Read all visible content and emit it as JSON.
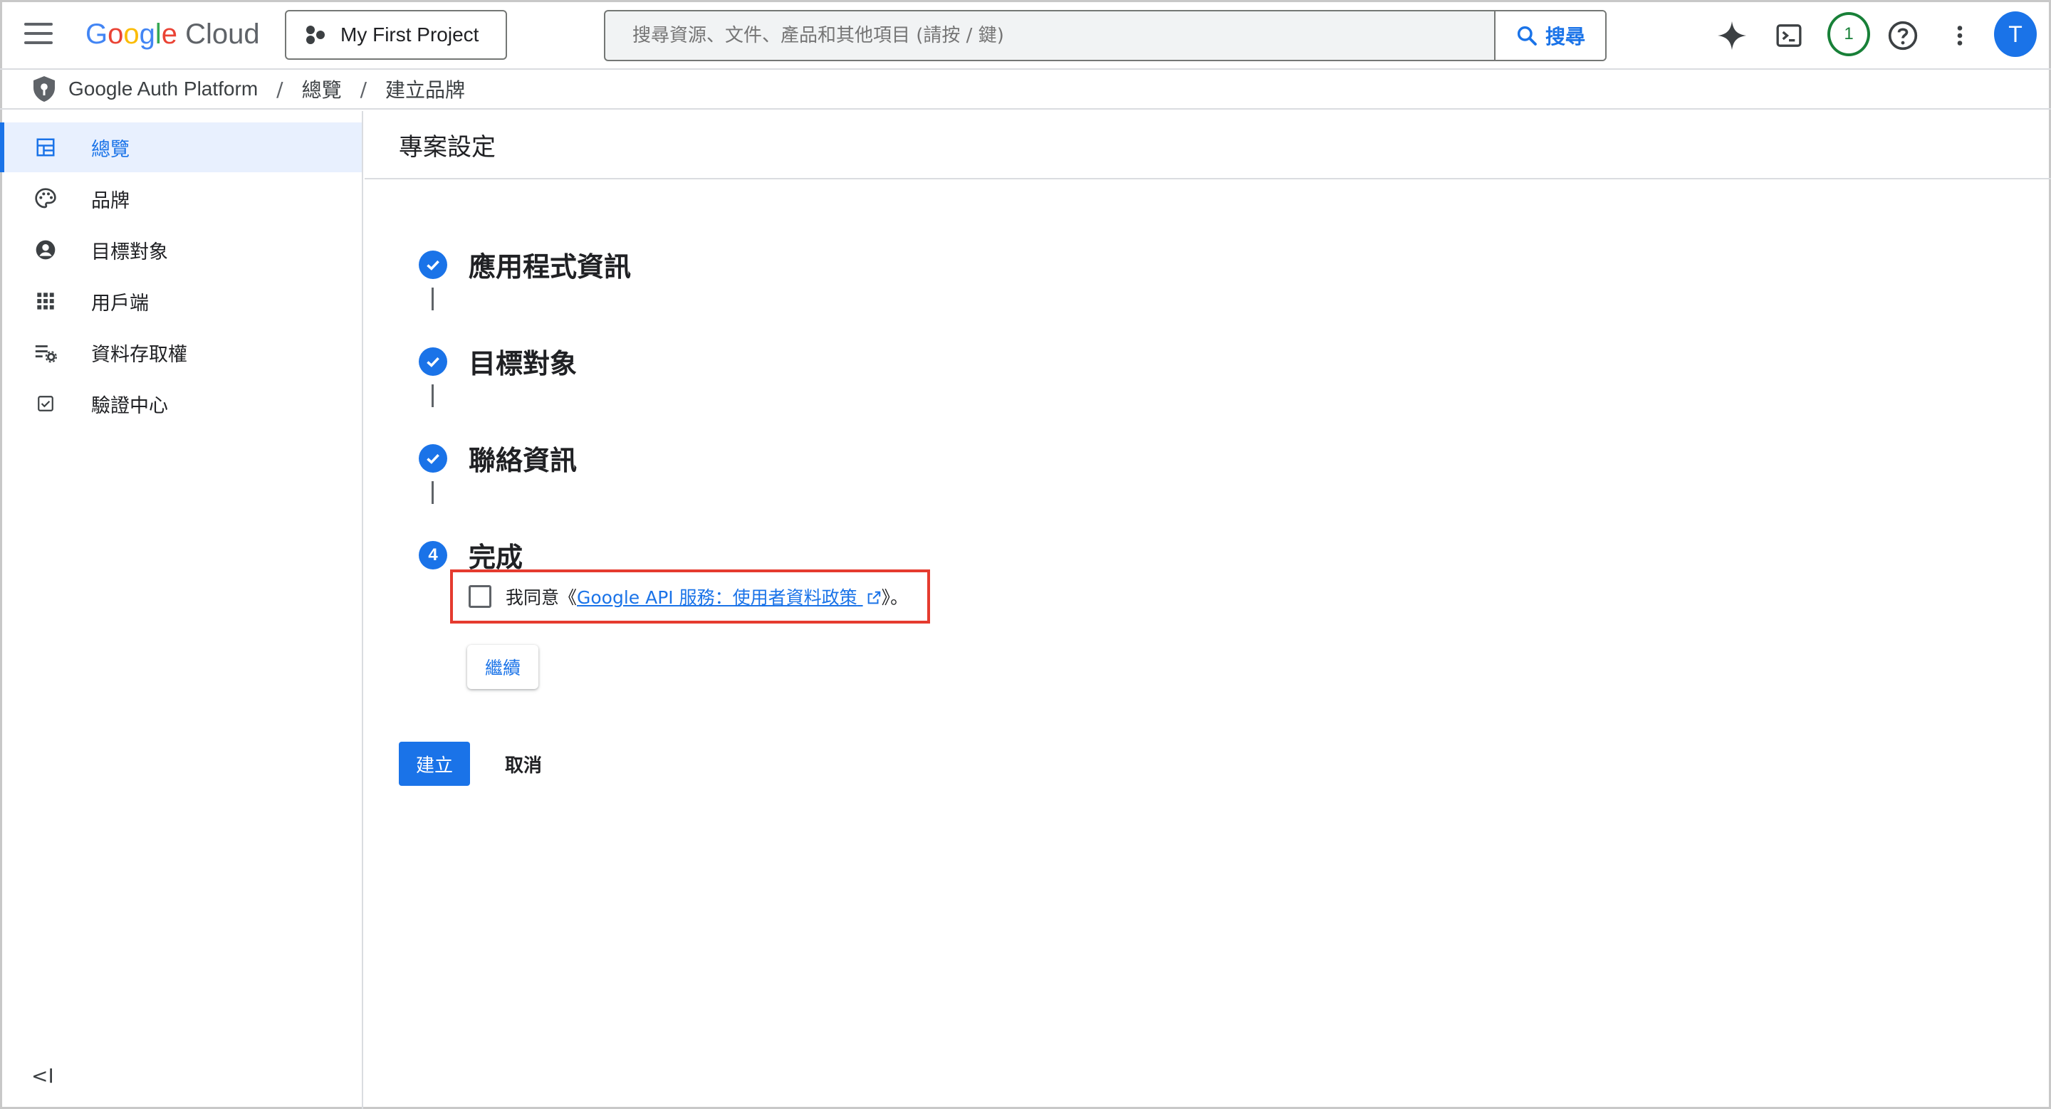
{
  "header": {
    "logo_google": [
      "G",
      "o",
      "o",
      "g",
      "l",
      "e"
    ],
    "logo_cloud": "Cloud",
    "project_label": "My First Project",
    "search_placeholder": "搜尋資源、文件、產品和其他項目 (請按 / 鍵)",
    "search_button_label": "搜尋",
    "notification_count": "1",
    "avatar_initial": "T"
  },
  "breadcrumb": {
    "items": [
      "Google Auth Platform",
      "總覽",
      "建立品牌"
    ],
    "separator": "/"
  },
  "sidebar": {
    "items": [
      {
        "label": "總覽",
        "icon": "dashboard-icon",
        "active": true
      },
      {
        "label": "品牌",
        "icon": "palette-icon",
        "active": false
      },
      {
        "label": "目標對象",
        "icon": "account-circle-icon",
        "active": false
      },
      {
        "label": "用戶端",
        "icon": "apps-grid-icon",
        "active": false
      },
      {
        "label": "資料存取權",
        "icon": "data-access-icon",
        "active": false
      },
      {
        "label": "驗證中心",
        "icon": "verification-icon",
        "active": false
      }
    ],
    "collapse_label": "<I"
  },
  "main": {
    "title": "專案設定",
    "steps": [
      {
        "label": "應用程式資訊",
        "state": "done"
      },
      {
        "label": "目標對象",
        "state": "done"
      },
      {
        "label": "聯絡資訊",
        "state": "done"
      },
      {
        "label": "完成",
        "state": "current",
        "number": "4"
      }
    ],
    "agreement": {
      "prefix": "我同意《",
      "link_text": "Google API 服務：使用者資料政策",
      "suffix": "》。",
      "checked": false
    },
    "continue_label": "繼續",
    "create_label": "建立",
    "cancel_label": "取消"
  },
  "colors": {
    "accent": "#1a73e8",
    "highlight_border": "#e53b2f",
    "notification": "#188038"
  }
}
